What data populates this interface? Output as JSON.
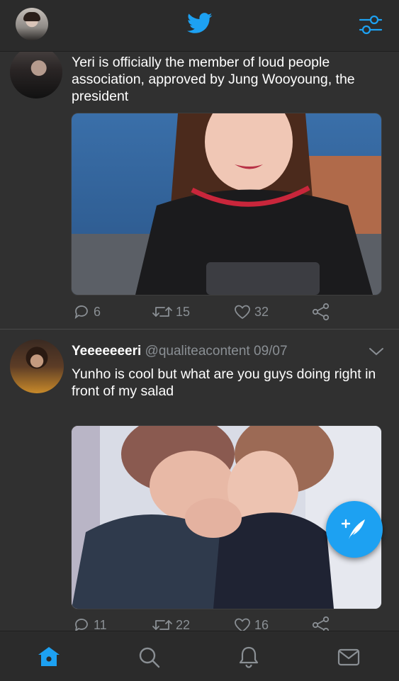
{
  "colors": {
    "accent": "#1da1f2",
    "background": "#303030",
    "bar": "#2b2b2b",
    "text_secondary": "#8a8f94"
  },
  "header": {
    "avatar_icon": "user-avatar",
    "logo_icon": "twitter-bird-icon",
    "filter_icon": "timeline-settings-icon"
  },
  "tweets": [
    {
      "text": "Yeri is officially the member of loud people association, approved by Jung Wooyoung, the president",
      "media": "photo",
      "actions": {
        "replies": "6",
        "retweets": "15",
        "likes": "32"
      }
    },
    {
      "name": "Yeeeeeeeri",
      "handle": "@qualiteacontent",
      "date": "09/07",
      "text": "Yunho is cool but what are you guys doing right in front of my salad",
      "media": "photo",
      "actions": {
        "replies": "11",
        "retweets": "22",
        "likes": "16"
      }
    }
  ],
  "fab": {
    "icon": "compose-tweet-icon"
  },
  "bottom_nav": [
    {
      "icon": "home-icon",
      "active": true
    },
    {
      "icon": "search-icon",
      "active": false
    },
    {
      "icon": "notifications-icon",
      "active": false
    },
    {
      "icon": "messages-icon",
      "active": false
    }
  ]
}
